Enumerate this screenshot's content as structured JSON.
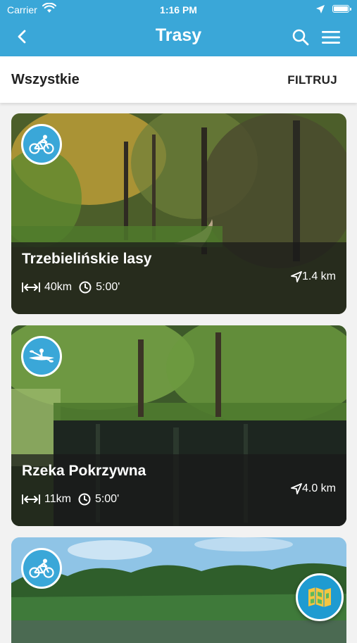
{
  "status_bar": {
    "carrier": "Carrier",
    "time": "1:16 PM",
    "icons": [
      "wifi-icon",
      "location-arrow-icon",
      "battery-icon"
    ]
  },
  "nav": {
    "title": "Trasy",
    "back_icon": "chevron-left-icon",
    "search_icon": "search-icon",
    "menu_icon": "hamburger-menu-icon"
  },
  "filter_bar": {
    "category": "Wszystkie",
    "filter_label": "FILTRUJ"
  },
  "routes": [
    {
      "title": "Trzebielińskie lasy",
      "length": "40km",
      "duration": "5:00'",
      "distance": "1.4 km",
      "type_icon": "bicycle-icon"
    },
    {
      "title": "Rzeka Pokrzywna",
      "length": "11km",
      "duration": "5:00'",
      "distance": "4.0 km",
      "type_icon": "kayak-icon"
    },
    {
      "title": "",
      "length": "",
      "duration": "",
      "distance": "",
      "type_icon": "bicycle-icon"
    }
  ],
  "map_button_icon": "map-icon",
  "colors": {
    "primary": "#3aa7d8",
    "fab": "#1f9bd1",
    "map_icon_yellow": "#f4c542",
    "map_icon_green": "#5cb85c"
  }
}
